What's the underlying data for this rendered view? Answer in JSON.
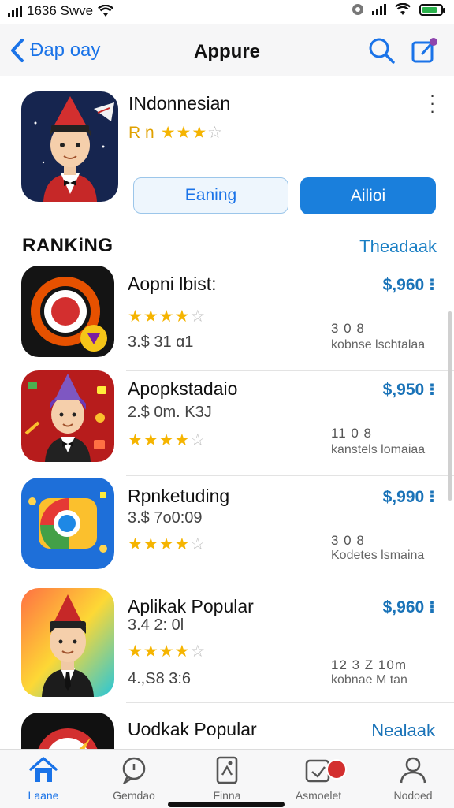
{
  "status": {
    "time": "1636 Swve"
  },
  "nav": {
    "back_label": "Đap oay",
    "title": "Appure"
  },
  "featured": {
    "name": "INdonnesian",
    "rating_label": "R n",
    "btn_secondary": "Eaning",
    "btn_primary": "Ailioi"
  },
  "section": {
    "title": "RANKiNG",
    "link": "Theadaak"
  },
  "apps": [
    {
      "name": "Aopni lbist:",
      "price": "$,960 ⁝",
      "meta1": "",
      "meta2": "3.$ 31 ɑ1",
      "nums": "3   0   8",
      "sub": "kobnse lschtalaa"
    },
    {
      "name": "Apopkstadaio",
      "price": "$,950 ⁝",
      "meta1": "2.$ 0m. K3J",
      "meta2": "",
      "nums": "11   0   8",
      "sub": "kanstels lomaiaa"
    },
    {
      "name": "Rpnketuding",
      "price": "$,990 ⁝",
      "meta1": "3.$ 7o0:09",
      "meta2": "",
      "nums": "3   0   8",
      "sub": "Kodetes lsmaina"
    },
    {
      "name": "Aplikak Popular",
      "price": "$,960 ⁝",
      "meta1": "3.4 2: 0l",
      "meta2": "4.,S8 3:6",
      "nums": "12   3   Z  10m",
      "sub": "kobnae M tan"
    },
    {
      "name": "Uodkak Popular",
      "price": "Nealaak",
      "meta1": "",
      "meta2": "",
      "nums": "",
      "sub": ""
    }
  ],
  "tabs": [
    {
      "label": "Laane",
      "icon": "home-icon"
    },
    {
      "label": "Gemdao",
      "icon": "chat-icon"
    },
    {
      "label": "Finna",
      "icon": "document-icon"
    },
    {
      "label": "Asmoelet",
      "icon": "updates-icon"
    },
    {
      "label": "Nodoed",
      "icon": "person-icon"
    }
  ],
  "colors": {
    "accent": "#1a73e8",
    "star": "#f5b400",
    "primary_button": "#1a7fdc"
  }
}
